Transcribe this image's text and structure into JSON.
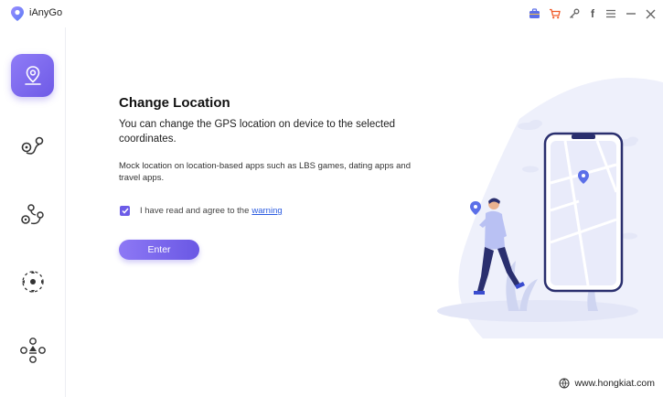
{
  "app": {
    "title": "iAnyGo"
  },
  "toolbar": {
    "icons": [
      "briefcase-icon",
      "cart-icon",
      "key-icon",
      "facebook-icon",
      "menu-icon",
      "minimize-icon",
      "close-icon"
    ],
    "facebook_glyph": "f",
    "accent": "#6c5ce7"
  },
  "sidebar": {
    "items": [
      {
        "name": "change-location",
        "icon": "map-pin-icon",
        "active": true
      },
      {
        "name": "two-spot-movement",
        "icon": "route-two-spot-icon",
        "active": false
      },
      {
        "name": "multi-spot-movement",
        "icon": "route-multi-spot-icon",
        "active": false
      },
      {
        "name": "joystick-movement",
        "icon": "joystick-icon",
        "active": false
      },
      {
        "name": "import-gpx",
        "icon": "directional-pad-icon",
        "active": false
      }
    ]
  },
  "main": {
    "heading": "Change Location",
    "description": "You can change the GPS location on device to the selected coordinates.",
    "note": "Mock location on location-based apps such as LBS games, dating apps and travel apps.",
    "agree_text": "I have read and agree to the",
    "warning_link": "warning",
    "agree_checked": true,
    "enter_button": "Enter"
  },
  "watermark": {
    "text": "www.hongkiat.com"
  }
}
